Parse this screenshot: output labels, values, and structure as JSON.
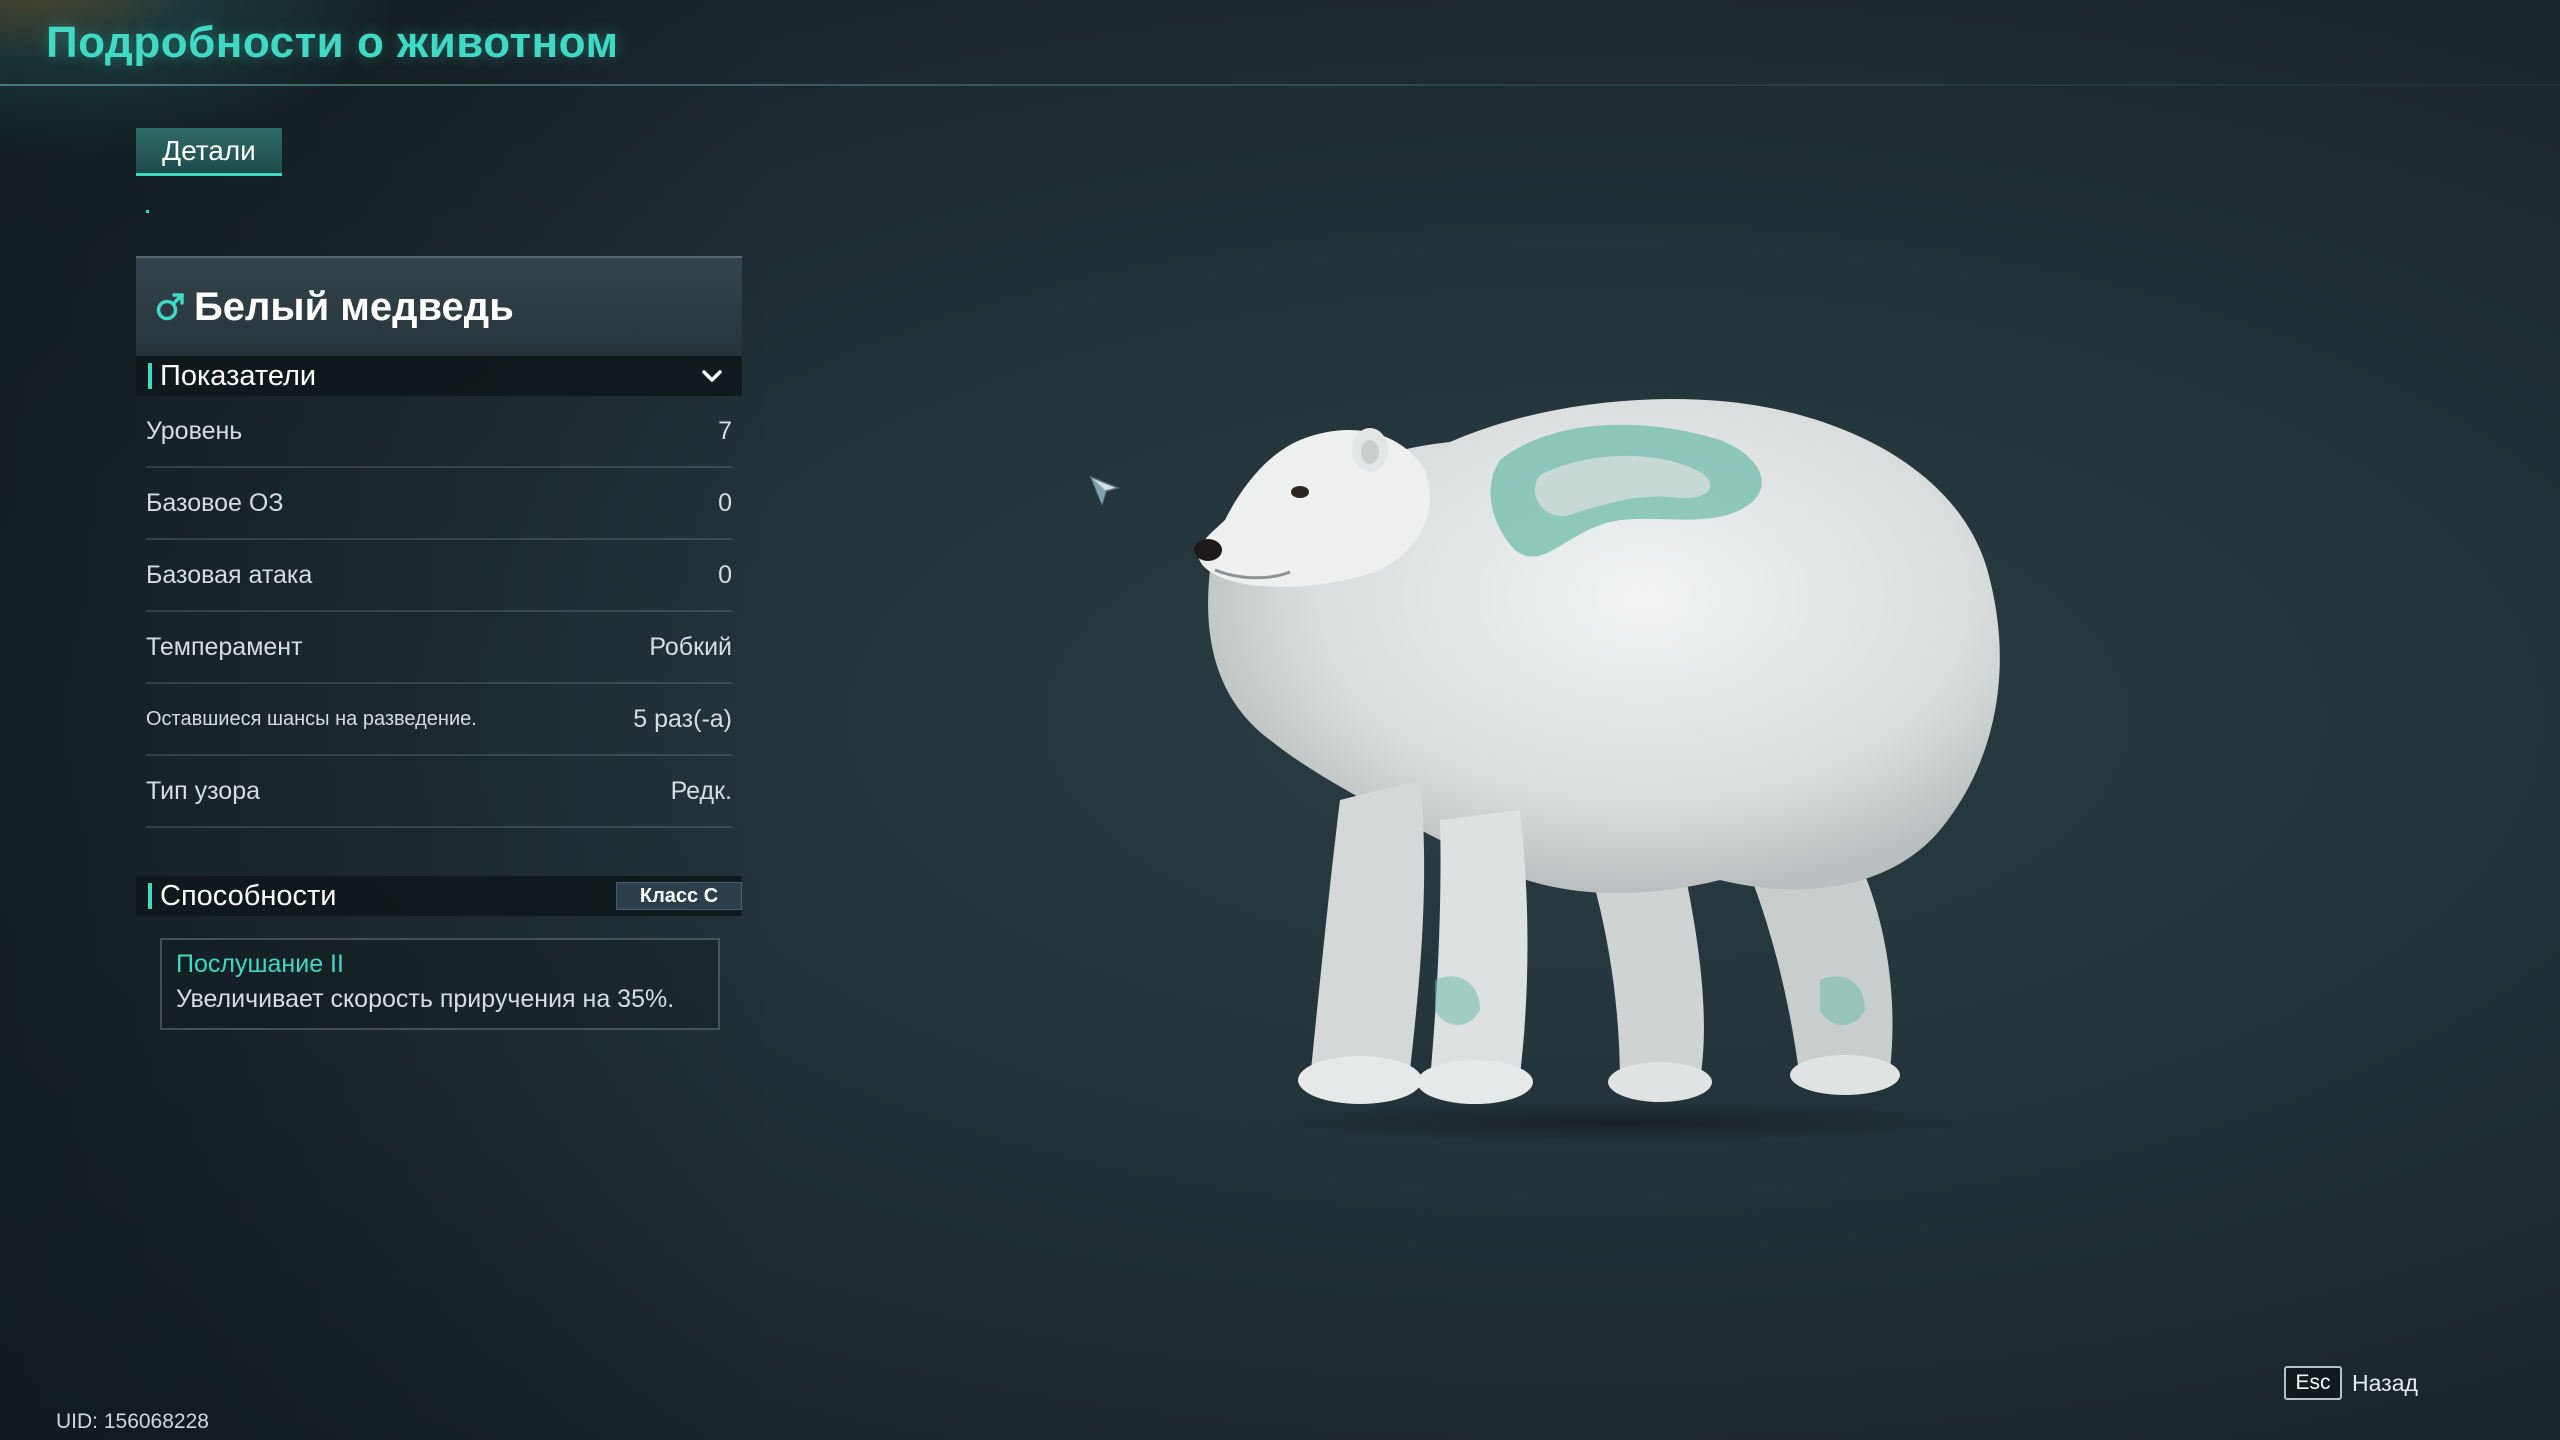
{
  "header": {
    "title": "Подробности о животном"
  },
  "tabs": [
    {
      "label": "Детали",
      "active": true
    }
  ],
  "animal": {
    "name": "Белый медведь",
    "gender_icon": "male-icon"
  },
  "stats": {
    "section_title": "Показатели",
    "rows": [
      {
        "label": "Уровень",
        "value": "7"
      },
      {
        "label": "Базовое ОЗ",
        "value": "0"
      },
      {
        "label": "Базовая атака",
        "value": "0"
      },
      {
        "label": "Темперамент",
        "value": "Робкий"
      },
      {
        "label": "Оставшиеся шансы на разведение.",
        "value": "5 раз(-а)"
      },
      {
        "label": "Тип узора",
        "value": "Редк."
      }
    ]
  },
  "abilities": {
    "section_title": "Способности",
    "class_badge": "Класс С",
    "items": [
      {
        "name": "Послушание II",
        "description": "Увеличивает скорость приручения на 35%."
      }
    ]
  },
  "footer": {
    "esc_key": "Esc",
    "back_label": "Назад",
    "uid": "UID: 156068228"
  },
  "colors": {
    "accent": "#3fd9c4",
    "background": "#223238",
    "panel": "#26343a"
  }
}
